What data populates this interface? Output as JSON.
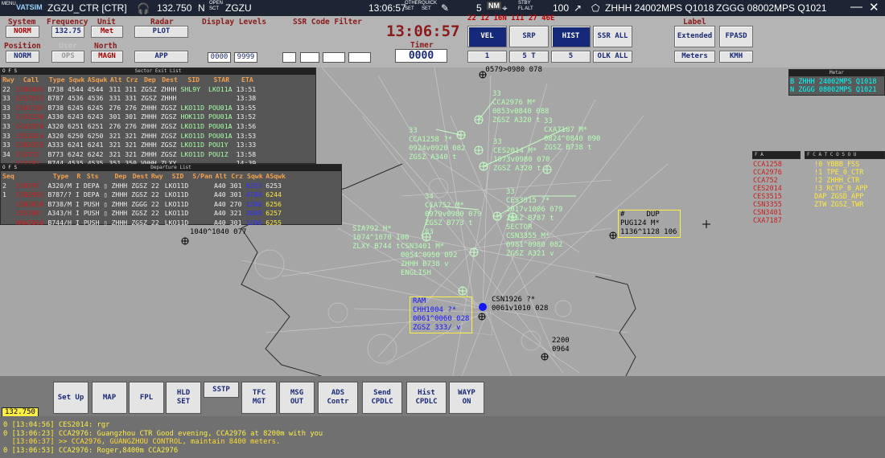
{
  "topbar": {
    "menu": "MENU",
    "logo": "VATSIM",
    "window_title": "ZGZU_CTR [CTR]",
    "frequency": "132.750",
    "status_letter": "N",
    "open_sct": "OPEN SCT",
    "sector": "ZGZU",
    "time": "13:06:57",
    "other_set": "OTHER SET",
    "quick_set": "QUICK SET",
    "count": "5",
    "nm": "NM",
    "stby_alt": "STBY FL ALT",
    "range": "100",
    "metar1": "ZHHH 24002MPS Q1018",
    "metar2": "ZGGG 08002MPS Q1021",
    "minimize": "—",
    "close": "✕"
  },
  "system": {
    "label": "System",
    "value": "NORM"
  },
  "position": {
    "label": "Position",
    "value": "NORM"
  },
  "frequency": {
    "label": "Frequency",
    "value": "132.75"
  },
  "user": {
    "label": "User",
    "value": "OPS"
  },
  "unit": {
    "label": "Unit",
    "value": "Met"
  },
  "north": {
    "label": "North",
    "value": "MAGN"
  },
  "radar": {
    "label": "Radar",
    "plot": "PLOT",
    "app": "APP"
  },
  "display_levels": {
    "label": "Display Levels",
    "low": "0000",
    "high": "9999"
  },
  "ssr_filter": {
    "label": "SSR Code Filter"
  },
  "clock": "13:06:57",
  "timer": {
    "label": "Timer",
    "value": "0000"
  },
  "red_status": "22 12 16N 111 27 46E",
  "vel": {
    "label": "VEL",
    "value": "1"
  },
  "srp": {
    "label": "SRP",
    "value": "5 T"
  },
  "hist": {
    "label": "HIST",
    "value": "5"
  },
  "ssr_all": "SSR ALL",
  "olk_all": "OLK ALL",
  "label_box": {
    "label": "Label",
    "extended": "Extended",
    "meters": "Meters",
    "fpasd": "FPASD",
    "kmh": "KMH"
  },
  "sector_exit": {
    "title": "Sector Exit List",
    "headers": [
      "Rwy",
      "Call",
      "Type",
      "Sqwk",
      "ASqwk",
      "Alt",
      "Crz",
      "Dep",
      "Dest",
      "SID",
      "STAR",
      "ETA"
    ],
    "rows": [
      [
        "22",
        "CSN3401",
        "B738",
        "4544",
        "4544",
        "311",
        "311",
        "ZGSZ",
        "ZHHH",
        "SHL9Y",
        "LKO11A",
        "13:51"
      ],
      [
        "33",
        "CES3515",
        "B787",
        "4536",
        "4536",
        "331",
        "331",
        "ZGSZ",
        "ZHHH",
        "",
        "",
        "13:38"
      ],
      [
        "33",
        "CXA7187",
        "B738",
        "6245",
        "6245",
        "276",
        "276",
        "ZHHH",
        "ZGSZ",
        "LKO11D",
        "POU01A",
        "13:55"
      ],
      [
        "33",
        "CCA1258",
        "A330",
        "6243",
        "6243",
        "301",
        "301",
        "ZHHH",
        "ZGSZ",
        "HOK11D",
        "POU01A",
        "13:52"
      ],
      [
        "33",
        "CCA2976",
        "A320",
        "6251",
        "6251",
        "276",
        "276",
        "ZHHH",
        "ZGSZ",
        "LKO11D",
        "POU01A",
        "13:56"
      ],
      [
        "33",
        "CES2014",
        "A320",
        "6250",
        "6250",
        "321",
        "321",
        "ZHHH",
        "ZGSZ",
        "LKO11D",
        "POU01A",
        "13:53"
      ],
      [
        "33",
        "CSN3355",
        "A333",
        "6241",
        "6241",
        "321",
        "321",
        "ZHHH",
        "ZGSZ",
        "LKO11D",
        "POU1Y",
        "13:33"
      ],
      [
        "34",
        "CCA752",
        "B773",
        "6242",
        "6242",
        "321",
        "321",
        "ZHHH",
        "ZGSZ",
        "LKO11D",
        "POU1Z",
        "13:58"
      ],
      [
        "",
        "SIA792",
        "B744",
        "4535",
        "4535",
        "351",
        "350",
        "VHHH",
        "ZLXY",
        "",
        "",
        "14:39"
      ]
    ]
  },
  "departure": {
    "title": "Departure List",
    "headers": [
      "Seq",
      "",
      "Type",
      "R",
      "Sts",
      "",
      "Dep",
      "Dest",
      "Rwy",
      "SID",
      "S/Pan",
      "Alt",
      "Crz",
      "Sqwk",
      "ASqwk"
    ],
    "rows": [
      [
        "2",
        "CSN797",
        "A320/M",
        "I",
        "DEPA",
        "",
        "ZHHH",
        "ZGSZ",
        "22",
        "LKO11D",
        "",
        "A40",
        "301",
        "6253",
        "6253"
      ],
      [
        "1",
        "CSN2992",
        "B787/?",
        "I",
        "DEPA",
        "",
        "ZHHH",
        "ZGSZ",
        "22",
        "LKO11D",
        "",
        "A40",
        "301",
        "4780",
        "6244"
      ],
      [
        "",
        "CSN3830",
        "B738/M",
        "I",
        "PUSH",
        "",
        "ZHHH",
        "ZGGG",
        "22",
        "LKO11D",
        "",
        "A40",
        "270",
        "1200",
        "6256"
      ],
      [
        "",
        "CES708",
        "A343/H",
        "I",
        "PUSH",
        "",
        "ZHHH",
        "ZGSZ",
        "22",
        "LKO11D",
        "",
        "A40",
        "321",
        "2000",
        "6257"
      ],
      [
        "",
        "HNA3060",
        "B744/H",
        "I",
        "PUSH",
        "",
        "ZHHH",
        "ZGSZ",
        "22",
        "LKO11D",
        "",
        "A40",
        "301",
        "1200",
        "6255"
      ]
    ]
  },
  "metar_win": {
    "title": "Metar",
    "lines": [
      "B ZHHH 24002MPS Q1018",
      "N ZGGG 08002MPS Q1021"
    ]
  },
  "arrival_list": {
    "title": "F A",
    "items": [
      "CCA1258",
      "CCA2976",
      "CCA752",
      "CES2014",
      "CES3515",
      "CSN3355",
      "CSN3401",
      "CXA7187"
    ]
  },
  "atc_list": {
    "title": "F C A T C O S O U",
    "items": [
      "!0 YBBB_FSS",
      "!1 TPE_0_CTR",
      "!2 ZHHH_CTR",
      "!3 RCTP_0_APP",
      "DAP ZGSD_APP",
      "ZTW ZGSZ_TWR"
    ]
  },
  "tags": {
    "t1": " 0579>0980 078",
    "t2": "33\nCCA2976 M*\n0853v0840 088\nZGSZ A320 t",
    "t3": "33\nCCA1258 ?*\n0924v0920 082\nZGSZ A340 t",
    "t4": "33\nCXA7187 M*\n0824^0840 090\nZGSZ B738 t",
    "t5": "33\nCES2014 M*\n1073v0980 070\nZGSZ A320 t",
    "t6": "34\nCCA752 M*\n0979v0980 079\nZGSZ B773 t\n83",
    "t7": "33\nCES3515 ?*\n1017v1006 079\nZGSZ B787 t\nSECTOR\nCSN3355 M*\n0981^0980 082\nZGSZ A321 v",
    "t8": "SIA792 H*\n1074^1070 100\nZLXY B744 t",
    "t9": "CSN3401 M*\n0054^0950 092\nZHHH B738 v\nENGLISH",
    "t10": "#     DUP\nPUG124 M*\n1136^1128 106",
    "t11": "1040^1040 077",
    "t12": "RAM\nCHH1004 ?*\n0061^0060 028\nZGSZ 333/ v",
    "t13": "CSN1926 ?*\n0061v1010 028",
    "t14": "2200\n0964"
  },
  "cmd": {
    "freq": "132.750",
    "setup": "Set Up",
    "map": "MAP",
    "fpl": "FPL",
    "hld": "HLD\nSET",
    "sstp": "SSTP",
    "tfc": "TFC\nMGT",
    "msg": "MSG\nOUT",
    "ads": "ADS\nContr",
    "send": "Send\nCPDLC",
    "hist": "Hist\nCPDLC",
    "wayp": "WAYP\nON"
  },
  "messages": [
    "0 [13:04:56] CES2014: rgr",
    "0 [13:06:23] CCA2976: Guangzhou CTR Good evening, CCA2976 at 8200m with you",
    "  [13:06:37] >> CCA2976, GUANGZHOU CONTROL, maintain 8400 meters.",
    "0 [13:06:53] CCA2976: Roger,8400m CCA2976"
  ],
  "colors": {
    "bg": "#a6a6a6",
    "tag": "#b6ffb6",
    "accent": "#8b1a1a"
  }
}
